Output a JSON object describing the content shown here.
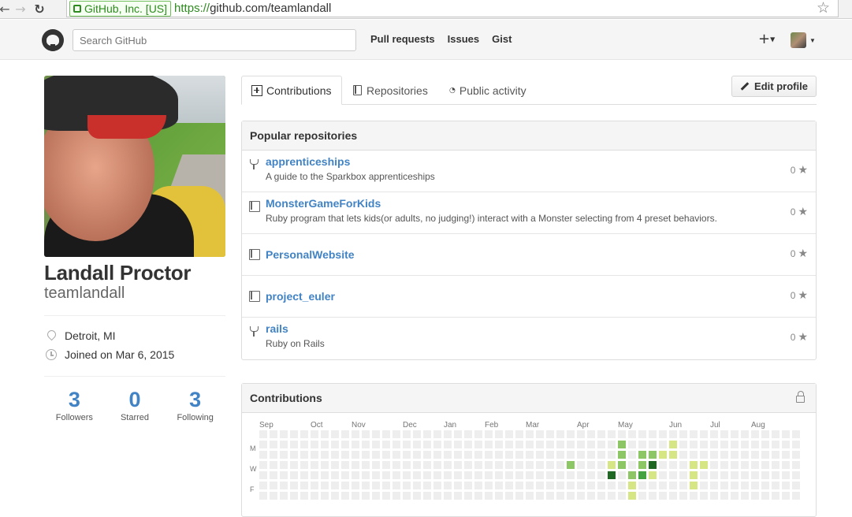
{
  "browser": {
    "ev_label": "GitHub, Inc. [US]",
    "url_scheme": "https://",
    "url_rest": "github.com/teamlandall"
  },
  "header": {
    "search_placeholder": "Search GitHub",
    "nav": [
      "Pull requests",
      "Issues",
      "Gist"
    ],
    "plus_label": "+"
  },
  "profile": {
    "fullname": "Landall Proctor",
    "username": "teamlandall",
    "location": "Detroit, MI",
    "joined": "Joined on Mar 6, 2015",
    "stats": [
      {
        "num": "3",
        "label": "Followers"
      },
      {
        "num": "0",
        "label": "Starred"
      },
      {
        "num": "3",
        "label": "Following"
      }
    ]
  },
  "tabs": [
    "Contributions",
    "Repositories",
    "Public activity"
  ],
  "edit_profile": "Edit profile",
  "popular": {
    "title": "Popular repositories",
    "repos": [
      {
        "name": "apprenticeships",
        "desc": "A guide to the Sparkbox apprenticeships",
        "stars": "0",
        "icon": "fork-icon"
      },
      {
        "name": "MonsterGameForKids",
        "desc": "Ruby program that lets kids(or adults, no judging!) interact with a Monster selecting from 4 preset behaviors.",
        "stars": "0",
        "icon": "book-icon"
      },
      {
        "name": "PersonalWebsite",
        "desc": "",
        "stars": "0",
        "icon": "book-icon"
      },
      {
        "name": "project_euler",
        "desc": "",
        "stars": "0",
        "icon": "book-icon"
      },
      {
        "name": "rails",
        "desc": "Ruby on Rails",
        "stars": "0",
        "icon": "fork-icon"
      }
    ]
  },
  "contributions": {
    "title": "Contributions",
    "months": [
      "Sep",
      "Oct",
      "Nov",
      "Dec",
      "Jan",
      "Feb",
      "Mar",
      "Apr",
      "May",
      "Jun",
      "Jul",
      "Aug"
    ],
    "month_weeks": [
      0,
      5,
      9,
      14,
      18,
      22,
      26,
      31,
      35,
      40,
      44,
      48
    ],
    "day_labels": [
      "M",
      "W",
      "F"
    ],
    "colors": [
      "#eeeeee",
      "#d6e685",
      "#8cc665",
      "#44a340",
      "#1e6823"
    ],
    "active_cells": [
      [
        35,
        1,
        2
      ],
      [
        40,
        1,
        1
      ],
      [
        35,
        2,
        2
      ],
      [
        37,
        2,
        2
      ],
      [
        38,
        2,
        2
      ],
      [
        39,
        2,
        1
      ],
      [
        40,
        2,
        1
      ],
      [
        30,
        3,
        2
      ],
      [
        34,
        3,
        1
      ],
      [
        35,
        3,
        2
      ],
      [
        37,
        3,
        2
      ],
      [
        38,
        3,
        4
      ],
      [
        42,
        3,
        1
      ],
      [
        43,
        3,
        1
      ],
      [
        34,
        4,
        4
      ],
      [
        36,
        4,
        2
      ],
      [
        37,
        4,
        3
      ],
      [
        38,
        4,
        1
      ],
      [
        42,
        4,
        1
      ],
      [
        36,
        5,
        1
      ],
      [
        42,
        5,
        1
      ],
      [
        36,
        6,
        1
      ]
    ]
  }
}
